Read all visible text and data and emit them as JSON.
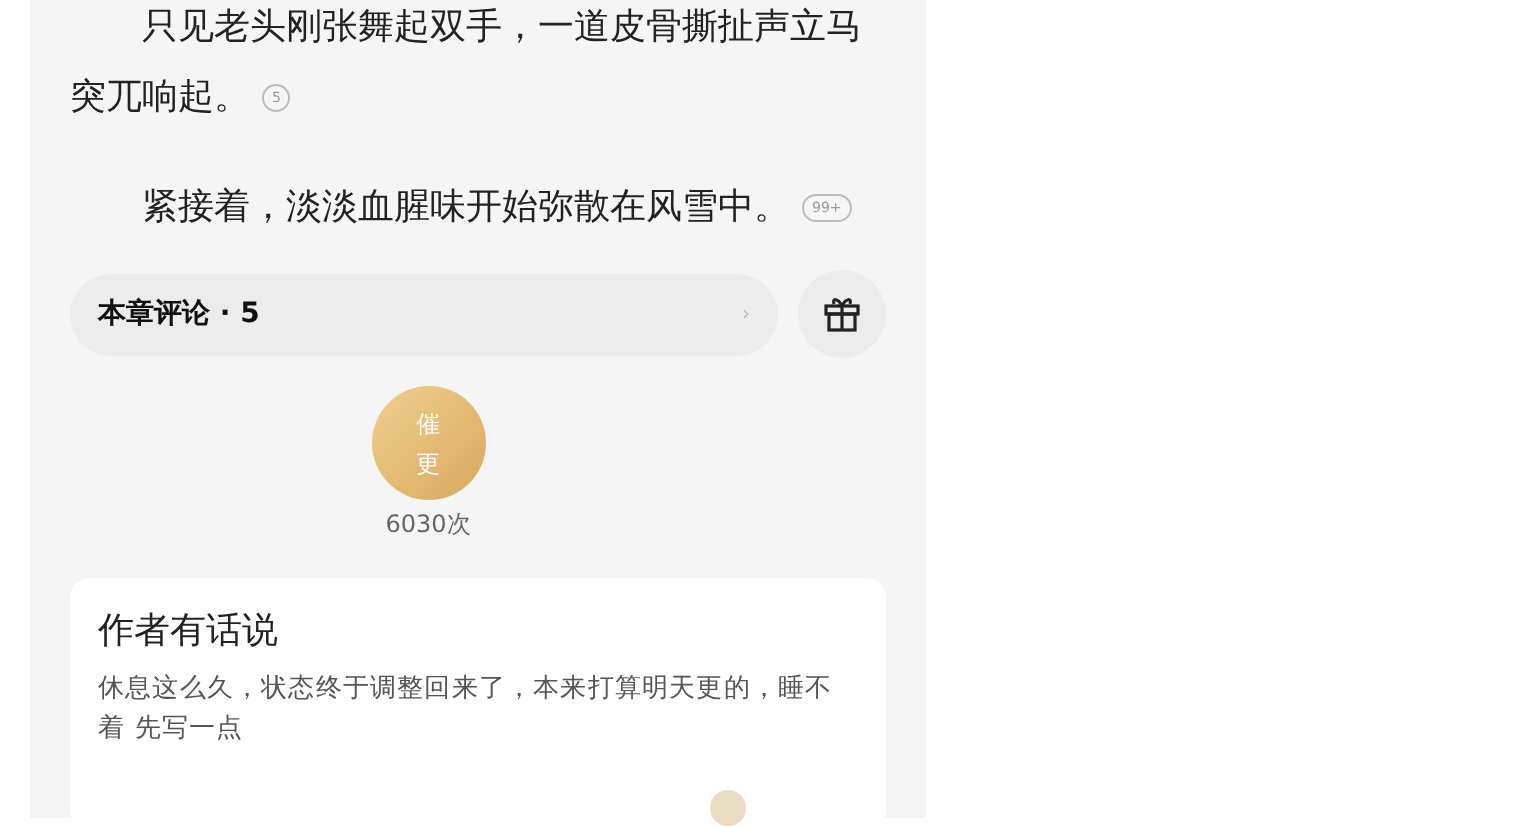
{
  "paragraphs": [
    {
      "text": "只见老头刚张舞起双手，一道皮骨撕扯声立马突兀响起。",
      "comment_count": "5"
    },
    {
      "text": "紧接着，淡淡血腥味开始弥散在风雪中。",
      "comment_count": "99+"
    }
  ],
  "comments_bar": {
    "label": "本章评论 · 5",
    "arrow": "›"
  },
  "urge_button": {
    "label": "催更",
    "count": "6030次"
  },
  "author_note": {
    "title": "作者有话说",
    "body": "休息这么久，状态终于调整回来了，本来打算明天更的，睡不着 先写一点"
  }
}
